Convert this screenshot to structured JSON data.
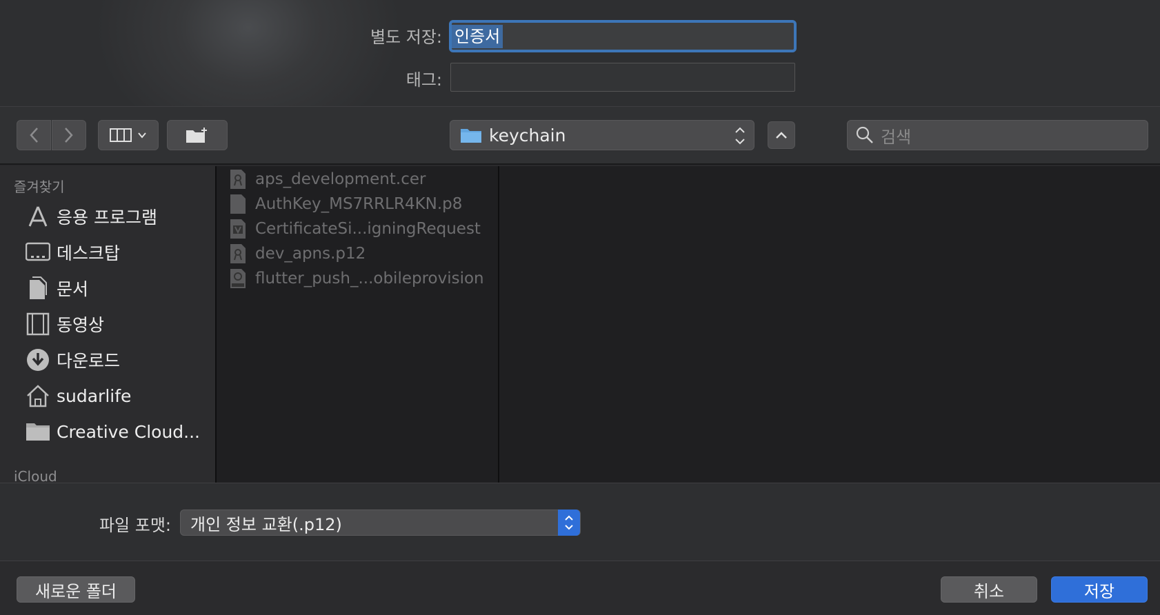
{
  "dialog": {
    "save_as_label": "별도 저장:",
    "save_as_value": "인증서",
    "tags_label": "태그:"
  },
  "toolbar": {
    "back_icon": "chevron-left-icon",
    "forward_icon": "chevron-right-icon",
    "view_icon": "column-view-icon",
    "new_folder_icon": "new-folder-icon",
    "location": "keychain",
    "search_placeholder": "검색"
  },
  "sidebar": {
    "favorites_heading": "즐겨찾기",
    "items": [
      {
        "label": "응용 프로그램",
        "icon": "applications-icon"
      },
      {
        "label": "데스크탑",
        "icon": "desktop-icon"
      },
      {
        "label": "문서",
        "icon": "documents-icon"
      },
      {
        "label": "동영상",
        "icon": "movies-icon"
      },
      {
        "label": "다운로드",
        "icon": "downloads-icon"
      },
      {
        "label": "sudarlife",
        "icon": "home-icon"
      },
      {
        "label": "Creative Cloud...",
        "icon": "folder-icon"
      }
    ],
    "icloud_heading": "iCloud"
  },
  "files": [
    {
      "name": "aps_development.cer",
      "icon": "certificate-icon"
    },
    {
      "name": "AuthKey_MS7RRLR4KN.p8",
      "icon": "document-icon"
    },
    {
      "name": "CertificateSi...igningRequest",
      "icon": "csr-icon"
    },
    {
      "name": "dev_apns.p12",
      "icon": "certificate-icon"
    },
    {
      "name": "flutter_push_...obileprovision",
      "icon": "provisioning-profile-icon"
    }
  ],
  "format": {
    "label": "파일 포맷:",
    "selected": "개인 정보 교환(.p12)"
  },
  "buttons": {
    "new_folder": "새로운 폴더",
    "cancel": "취소",
    "save": "저장"
  },
  "colors": {
    "accent": "#2f6fd9",
    "focus_ring": "#3d76b8",
    "background": "#2a2a2c"
  }
}
